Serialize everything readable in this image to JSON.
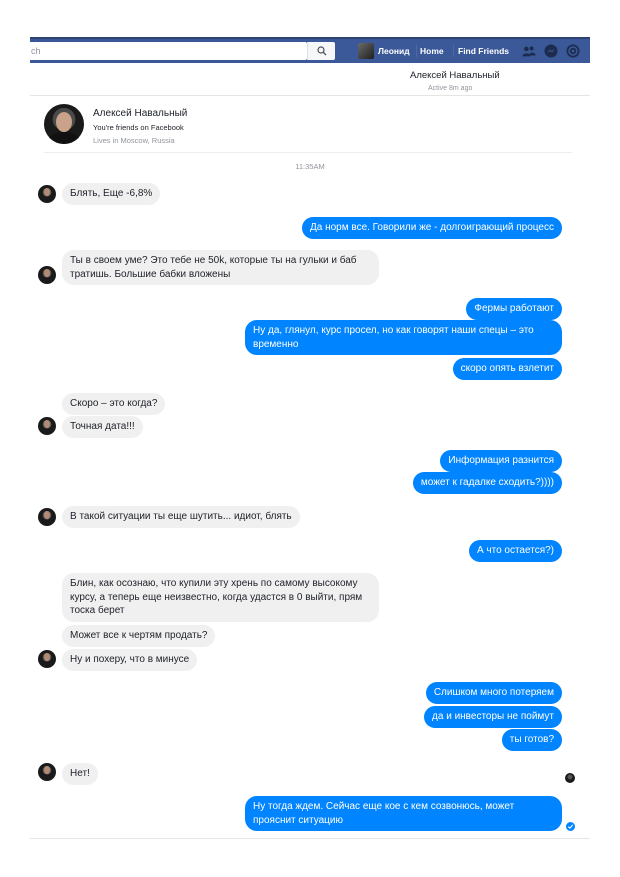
{
  "topbar": {
    "search_placeholder": "ch",
    "user_name": "Леонид",
    "home_label": "Home",
    "find_friends_label": "Find Friends",
    "icons": [
      "friend-requests-icon",
      "messenger-icon",
      "notifications-icon"
    ],
    "brand_color": "#3b5998"
  },
  "conversation": {
    "name": "Алексей Навальный",
    "status": "Active 8m ago"
  },
  "profile": {
    "name": "Алексей Навальный",
    "friends_text": "You're friends on Facebook",
    "lives_text": "Lives in Moscow, Russia"
  },
  "timestamp": "11:35AM",
  "colors": {
    "outgoing": "#0084ff",
    "incoming": "#f1f0f0"
  },
  "messages": [
    {
      "side": "in",
      "text": "Блять, Еще -6,8%"
    },
    {
      "side": "out",
      "text": "Да норм все. Говорили же - долгоиграющий процесс"
    },
    {
      "side": "in",
      "text": "Ты в своем уме? Это тебе не 50k, которые ты на гульки и баб тратишь. Большие бабки вложены"
    },
    {
      "side": "out",
      "text": "Фермы работают"
    },
    {
      "side": "out",
      "text": "Ну да, глянул, курс просел, но как говорят наши спецы – это временно"
    },
    {
      "side": "out",
      "text": "скоро опять взлетит"
    },
    {
      "side": "in",
      "text": "Скоро – это когда?"
    },
    {
      "side": "in",
      "text": "Точная дата!!!"
    },
    {
      "side": "out",
      "text": "Информация разнится"
    },
    {
      "side": "out",
      "text": "может к  гадалке сходить?))))"
    },
    {
      "side": "in",
      "text": "В такой ситуации ты еще шутить... идиот, блять"
    },
    {
      "side": "out",
      "text": "А что остается?)"
    },
    {
      "side": "in",
      "text": "Блин, как осознаю, что купили эту хрень по самому высокому курсу, а теперь еще неизвестно, когда удастся в 0 выйти, прям тоска берет"
    },
    {
      "side": "in",
      "text": "Может  все к чертям продать?"
    },
    {
      "side": "in",
      "text": "Ну и похеру, что в минусе"
    },
    {
      "side": "out",
      "text": "Слишком много потеряем"
    },
    {
      "side": "out",
      "text": "да и инвесторы не поймут"
    },
    {
      "side": "out",
      "text": "ты готов?"
    },
    {
      "side": "in",
      "text": "Нет!"
    },
    {
      "side": "out",
      "text": "Ну тогда ждем. Сейчас еще кое с кем созвонюсь, может прояснит ситуацию"
    }
  ]
}
